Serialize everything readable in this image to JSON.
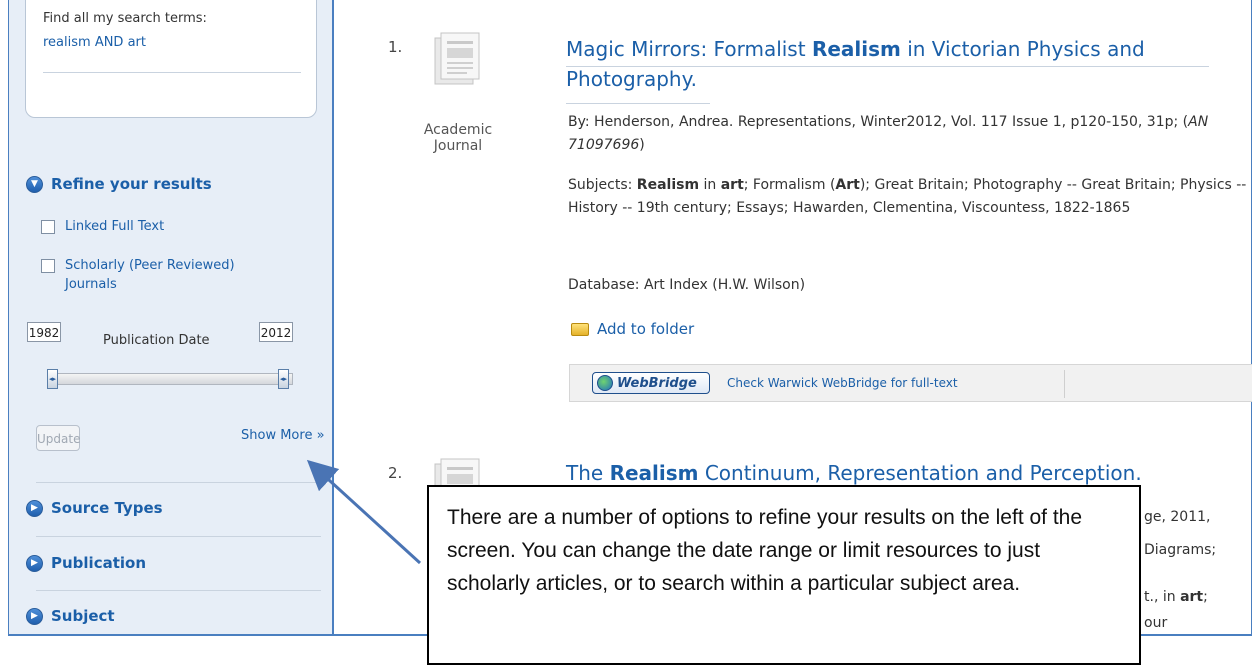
{
  "sidebar": {
    "search_terms_label": "Find all my search terms:",
    "search_terms_link": "realism AND art",
    "refine_heading": "Refine your results",
    "limiters": [
      {
        "label": "Linked Full Text",
        "checked": false
      },
      {
        "label": "Scholarly (Peer Reviewed) Journals",
        "checked": false
      }
    ],
    "date_from": "1982",
    "date_to": "2012",
    "date_label": "Publication Date",
    "update_label": "Update",
    "show_more_label": "Show More »",
    "facets": [
      "Source Types",
      "Publication",
      "Subject"
    ]
  },
  "results": [
    {
      "number": "1.",
      "type_label": "Academic Journal",
      "title_pre": "Magic Mirrors: Formalist ",
      "title_bold": "Realism",
      "title_post": " in Victorian Physics and Photography.",
      "byline": "By: Henderson, Andrea. Representations, Winter2012, Vol. 117 Issue 1, p120-150, 31p; (",
      "an": "AN 71097696",
      "byline_end": ")",
      "subjects_html_parts": [
        "Subjects: ",
        "Realism",
        " in ",
        "art",
        "; Formalism (",
        "Art",
        "); Great Britain; Photography -- Great Britain; Physics -- History -- 19th century; Essays; Hawarden, Clementina, Viscountess, 1822-1865"
      ],
      "database": "Database: Art Index (H.W. Wilson)",
      "add_to_folder": "Add to folder",
      "webbridge_logo": "WebBridge",
      "webbridge_link": "Check Warwick WebBridge for full-text"
    },
    {
      "number": "2.",
      "title_pre": "The ",
      "title_bold": "Realism",
      "title_post": " Continuum, Representation and Perception.",
      "partial_1": "ge, 2011,",
      "partial_2": "Diagrams;",
      "partial_3a": "t., in ",
      "partial_3b": "art",
      "partial_3c": ";",
      "partial_4": "our"
    }
  ],
  "callout": {
    "text": "There are a number of options to refine your results on the left of the screen. You can change the date range or limit resources to just scholarly articles, or to search within a particular subject area."
  },
  "colors": {
    "accent": "#1b5fa8",
    "sidebar_bg": "#e7eef7",
    "border": "#4a7fc0",
    "arrow": "#4a74b4"
  }
}
